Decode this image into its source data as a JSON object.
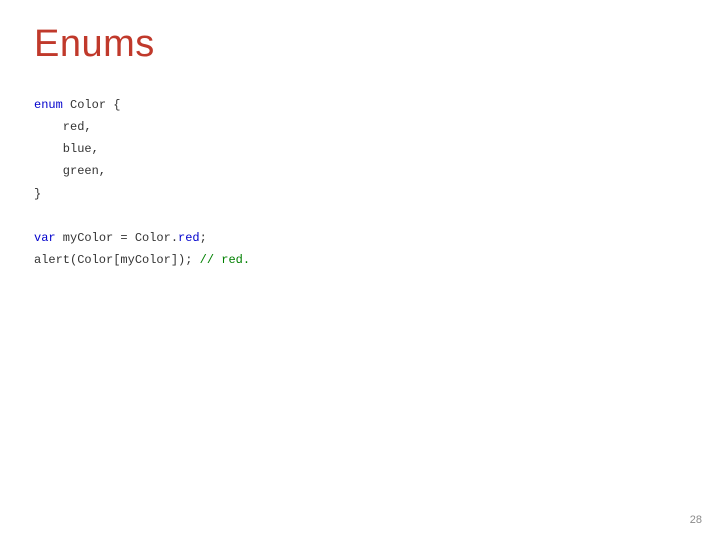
{
  "title": "Enums",
  "page_number": "28",
  "code": {
    "l1_kw": "enum",
    "l1_rest": " Color {",
    "l2": "    red,",
    "l3": "    blue,",
    "l4": "    green,",
    "l5": "}",
    "blank": "",
    "l6_kw": "var",
    "l6_mid": " myColor = Color.",
    "l6_prop": "red",
    "l6_end": ";",
    "l7_call": "alert(Color[myColor]); ",
    "l7_cmt": "// red."
  }
}
